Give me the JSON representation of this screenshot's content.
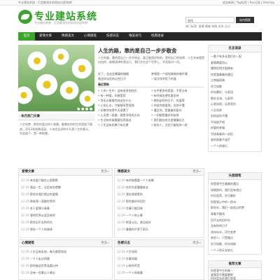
{
  "topbar": {
    "left_text": "专业建站系统 - 打造最领先的网站内容系统!",
    "right_text": "退站新闻 | Tag标签 | Rss订阅 | Sitemap"
  },
  "logo": {
    "title": "专业建站系统",
    "subtitle": "专业建站系统 · 打造最领先的网站内容系统!"
  },
  "search": {
    "placeholder": "查找",
    "button": "站内搜索",
    "hot_label": "热门标签:",
    "hot_words": "爱情 情感 亲情 关系 日记"
  },
  "nav": [
    "首页",
    "爱情文章",
    "情感美文",
    "心情随笔",
    "伤感日志",
    "唯美语句",
    "经典语录"
  ],
  "feature": {
    "dots": "● ● ● ●",
    "title": "人生的路，靠的是自己一步步敬舍",
    "desc": "人生的路，靠的是自己一步步地走，真正能保护你的，是你自己的选择，人生本来就是自由的，能够选择的是自己，我们活在这个世界上，学会面对一切。",
    "col_a": [
      "好了，会这会暴露的婚姻",
      "就这样淡定的过完日子"
    ],
    "col_b": [
      "梦想是一个很如果做的哪件事",
      "一笑冷场专柜下的爱"
    ],
    "latest_label": "最近更新",
    "latest_left": [
      "人的一生中，会有很多的经历",
      "有一种爱，叫做宽容",
      "你无论能够完成这些什么",
      "心如止水，才能够享受孤独",
      "如果你觉得今天很累了",
      "心灵是一条路，都是寻找的方向",
      "生活有时候需要坦然面对",
      "人生没有如果只有后果"
    ],
    "latest_right": [
      "在乎更多的是爱，不是占有",
      "有时候失望也要坚持",
      "哪怕这样的日子，也值得",
      "你说你很爱我，但你不懂",
      "遇见你，是最美的意外",
      "一切都是最好的安排",
      "我们都在时光里慢慢长大",
      "有些人，注定只能陪你一程"
    ]
  },
  "hot_articles": {
    "title": "本月热门文章",
    "text": "人生如梦，那些你爱过的人和事，都曾在你的生命里留下痕迹。2013年经典语录，十句话告诉你什么是人生的意义，学会放下，是一种智慧。"
  },
  "right_top": {
    "title": "名言语录",
    "items": [
      "一辈子有多长我们在一起",
      "爱情需要用心",
      "懂得珍惜才配拥有",
      "你是我最美的遇见",
      "江南烟雨情",
      "岁月如歌",
      "时光静好，与君语",
      "细水长流，与君同",
      "心若向阳，无畏悲伤",
      "人生如茶",
      "别再说你不懂",
      "不如放手吧",
      "你要的幸福",
      "写给青春的一封信",
      "谁的青春不迷茫",
      "一个人的旅行"
    ]
  },
  "love_articles": {
    "title": "爱情文章",
    "more": "更多»",
    "items": [
      [
        "12-29",
        "有些爱只能在心里默默"
      ],
      [
        "12-29",
        "我这一生，注定有些遗憾"
      ],
      [
        "12-29",
        "那些年我们错过的爱情"
      ],
      [
        "12-29",
        "原来我一直都在等你"
      ],
      [
        "12-29",
        "关于爱情与青春"
      ],
      [
        "12-29",
        "我的世界从此没有你"
      ],
      [
        "12-29",
        "那些回不去的时光"
      ],
      [
        "12-29",
        "想念一个人的滋味"
      ]
    ]
  },
  "emotion_articles": {
    "title": "情感美文",
    "more": "更多»",
    "items": [
      [
        "12-29",
        "有时候需要一个人安静"
      ],
      [
        "12-29",
        "在时光里慢慢老去"
      ],
      [
        "12-29",
        "我在原地等你"
      ],
      [
        "12-29",
        "那些美好的回忆"
      ],
      [
        "12-29",
        "往事只能回味"
      ],
      [
        "12-29",
        "一个人的心事"
      ],
      [
        "12-29",
        "转身以后，各自安好"
      ],
      [
        "12-29",
        "最美的不是下雨天"
      ]
    ]
  },
  "right_mid": {
    "title": "头版随笔",
    "items": [
      "你是我今生最美的遇见",
      "如果那时，我们没有错过",
      "时光荏苒，岁月静好",
      "你是我心中的一首诗",
      "那些年，我们一起追过的梦",
      "青春不散场",
      "回不去的旧时光",
      "没有你的日子",
      "流年似水，浮生若梦",
      "有些人，只是路过",
      "岁月如歌，时光如梭",
      "一个人的天长地久"
    ]
  },
  "mood": {
    "title": "心情随笔",
    "more": "更多»",
    "items": [
      [
        "12-29",
        "人生没有彩排，每天都是现场"
      ],
      [
        "12-29",
        "一个人走过的路"
      ],
      [
        "12-29",
        "愿你被这世界温柔以待"
      ],
      [
        "12-29",
        "总有一些事让人难忘"
      ]
    ]
  },
  "sad": {
    "title": "伤感日志",
    "more": "更多»",
    "items": [
      [
        "12-29",
        "人生如戏"
      ],
      [
        "12-29",
        "往事如烟"
      ],
      [
        "12-29",
        "心碎的声音"
      ],
      [
        "12-29",
        "一个人的寂寞"
      ]
    ]
  },
  "right_bottom": {
    "title": "推荐文章",
    "items": [
      "你是我今生的唯一",
      "爱情里不需要解释",
      "时间会告诉我们答案"
    ]
  }
}
